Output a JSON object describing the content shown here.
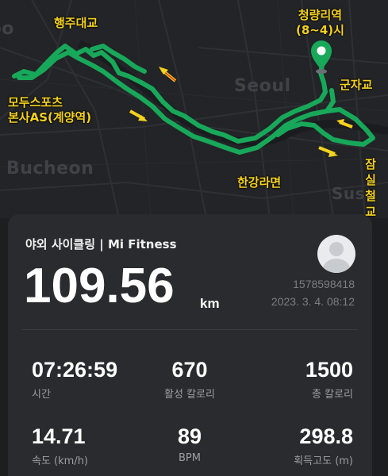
{
  "map": {
    "place_labels": {
      "seoul": "Seoul",
      "bucheon": "Bucheon",
      "suseo": "Suse",
      "gimpo": "po"
    },
    "annotations": {
      "haengju": "행주대교",
      "modu_line1": "모두스포츠",
      "modu_line2": "본사AS(계양역)",
      "cheongnyang_line1": "청량리역",
      "cheongnyang_line2": "(8~4)시",
      "gunja": "군자교",
      "hangang": "한강라면",
      "jamsil": "잠실철교"
    },
    "route_color": "#18a85a",
    "annotation_color": "#f6d21c",
    "icons": [
      "location-pin-icon",
      "direction-arrow-icon"
    ]
  },
  "activity": {
    "title": "야외 사이클링 | Mi Fitness",
    "distance": "109.56",
    "distance_unit": "km",
    "user_id": "1578598418",
    "timestamp": "2023. 3. 4. 08:12"
  },
  "stats": {
    "duration": {
      "value": "07:26:59",
      "label": "시간"
    },
    "active_calories": {
      "value": "670",
      "label": "활성 칼로리"
    },
    "total_calories": {
      "value": "1500",
      "label": "총 칼로리"
    },
    "speed": {
      "value": "14.71",
      "label": "속도 (km/h)"
    },
    "heart_rate": {
      "value": "89",
      "label": "BPM"
    },
    "elevation_gain": {
      "value": "298.8",
      "label": "획득고도 (m)"
    }
  }
}
